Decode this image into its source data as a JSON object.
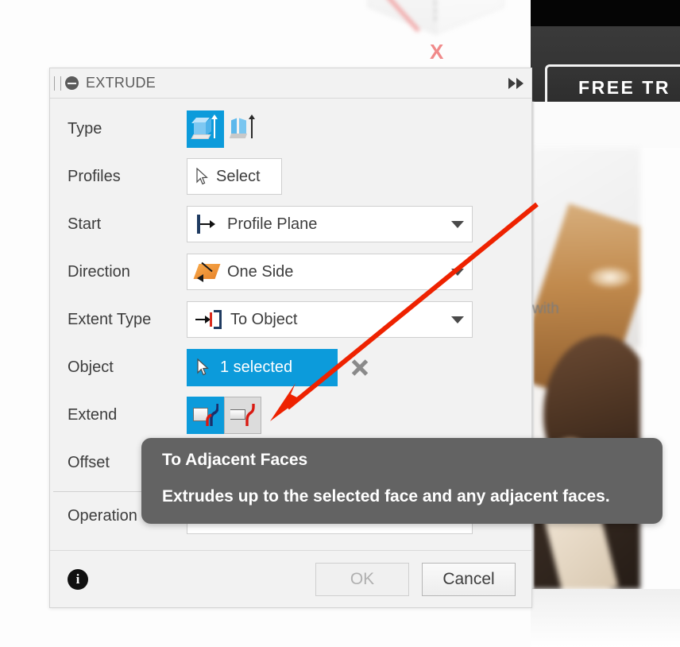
{
  "background": {
    "free_trial_label": "FREE TR",
    "blurred_text": "with",
    "viewcube_axis_label": "X"
  },
  "panel": {
    "title": "EXTRUDE",
    "collapse_icon": "circle-minus-icon",
    "grip_icon": "drag-grip-icon",
    "expand_icon": "fast-forward-icon",
    "rows": {
      "type": {
        "label": "Type",
        "options": [
          {
            "name": "solid-extrude",
            "selected": true
          },
          {
            "name": "thin-extrude",
            "selected": false
          }
        ]
      },
      "profiles": {
        "label": "Profiles",
        "value": "Select",
        "icon": "cursor-arrow-icon"
      },
      "start": {
        "label": "Start",
        "value": "Profile Plane",
        "icon": "profile-plane-icon"
      },
      "direction": {
        "label": "Direction",
        "value": "One Side",
        "icon": "one-side-direction-icon"
      },
      "extent_type": {
        "label": "Extent Type",
        "value": "To Object",
        "icon": "to-object-icon"
      },
      "object": {
        "label": "Object",
        "value": "1 selected",
        "icon": "cursor-arrow-icon",
        "clear_icon": "close-x-icon"
      },
      "extend": {
        "label": "Extend",
        "options": [
          {
            "name": "to-selected-face",
            "selected": true
          },
          {
            "name": "to-adjacent-faces",
            "selected": false
          }
        ]
      },
      "offset": {
        "label": "Offset"
      },
      "operation": {
        "label": "Operation"
      }
    },
    "footer": {
      "info_icon": "info-icon",
      "ok_label": "OK",
      "ok_disabled": true,
      "cancel_label": "Cancel"
    }
  },
  "tooltip": {
    "title": "To Adjacent Faces",
    "body": "Extrudes up to the selected face and any adjacent faces."
  },
  "colors": {
    "accent_blue": "#0c9bdb",
    "panel_bg": "#f2f2f2",
    "tooltip_bg": "#636363",
    "annotation_red": "#ee2200"
  }
}
